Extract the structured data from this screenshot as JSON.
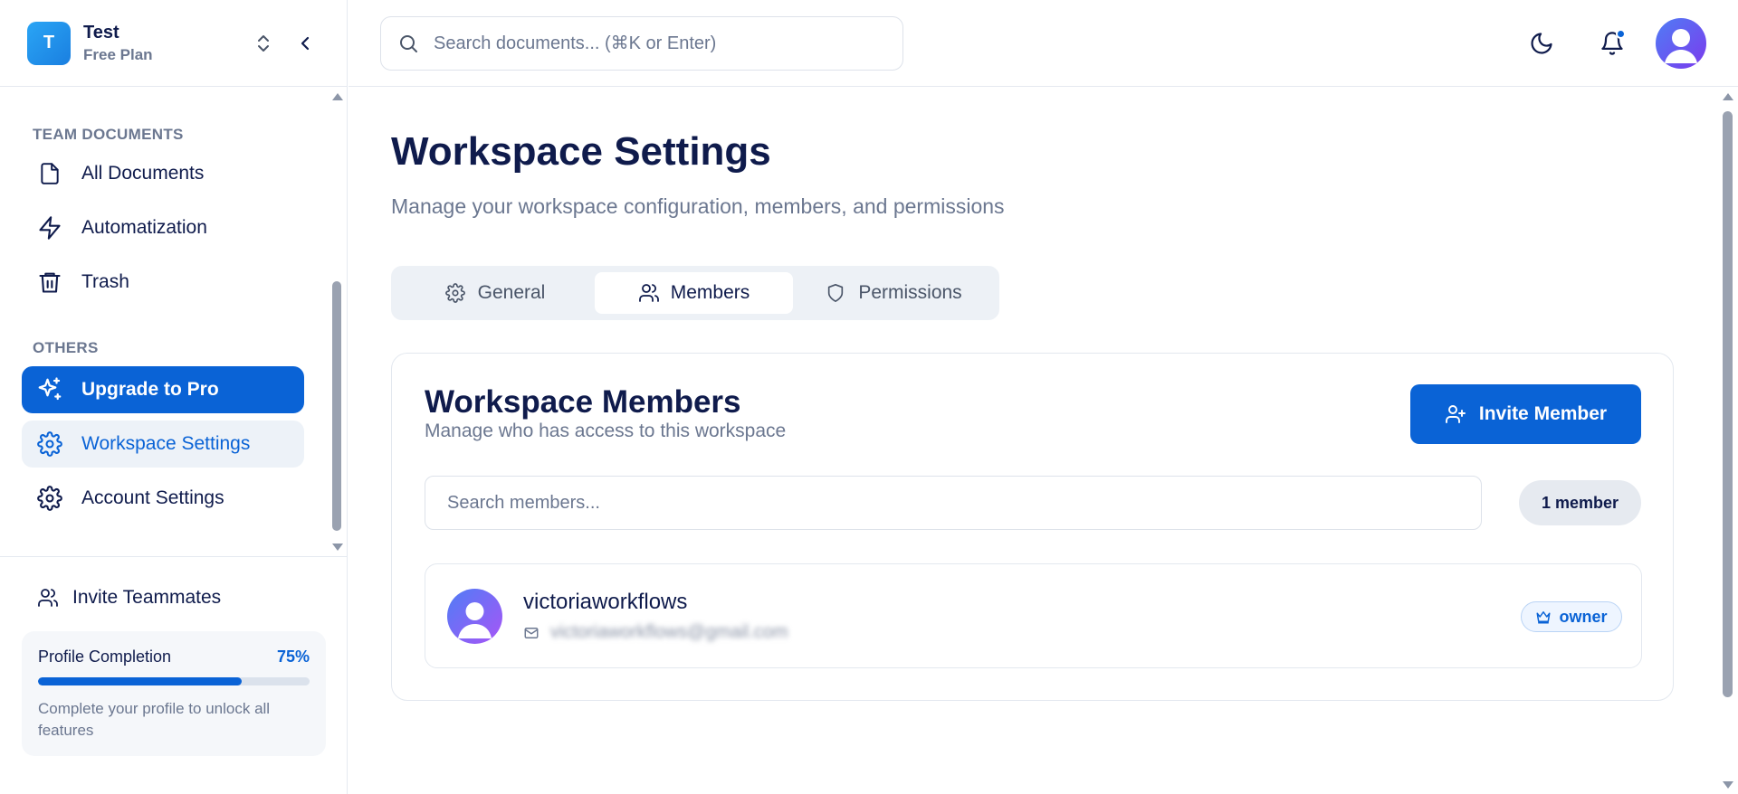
{
  "workspace": {
    "initial": "T",
    "name": "Test",
    "plan": "Free Plan"
  },
  "sidebar": {
    "section_team": "TEAM DOCUMENTS",
    "team_items": [
      {
        "label": "All Documents",
        "icon": "file-icon"
      },
      {
        "label": "Automatization",
        "icon": "lightning-icon"
      },
      {
        "label": "Trash",
        "icon": "trash-icon"
      }
    ],
    "section_others": "OTHERS",
    "other_items": [
      {
        "label": "Upgrade to Pro",
        "icon": "sparkles-icon"
      },
      {
        "label": "Workspace Settings",
        "icon": "gear-icon"
      },
      {
        "label": "Account Settings",
        "icon": "gear-icon"
      }
    ],
    "invite_label": "Invite Teammates",
    "profile": {
      "title": "Profile Completion",
      "percent_label": "75%",
      "percent": 0.75,
      "description": "Complete your profile to unlock all features"
    }
  },
  "topbar": {
    "search_placeholder": "Search documents... (⌘K or Enter)"
  },
  "page": {
    "title": "Workspace Settings",
    "subtitle": "Manage your workspace configuration, members, and permissions",
    "tabs": [
      {
        "label": "General",
        "icon": "gear-icon"
      },
      {
        "label": "Members",
        "icon": "users-icon",
        "active": true
      },
      {
        "label": "Permissions",
        "icon": "shield-icon"
      }
    ]
  },
  "members_card": {
    "title": "Workspace Members",
    "subtitle": "Manage who has access to this workspace",
    "invite_button": "Invite Member",
    "search_placeholder": "Search members...",
    "count_label": "1 member",
    "members": [
      {
        "name": "victoriaworkflows",
        "email": "victoriaworkflows@gmail.com",
        "role": "owner"
      }
    ]
  },
  "colors": {
    "accent": "#0a63d6",
    "text_primary": "#0f1b4c",
    "text_muted": "#6b7790"
  }
}
